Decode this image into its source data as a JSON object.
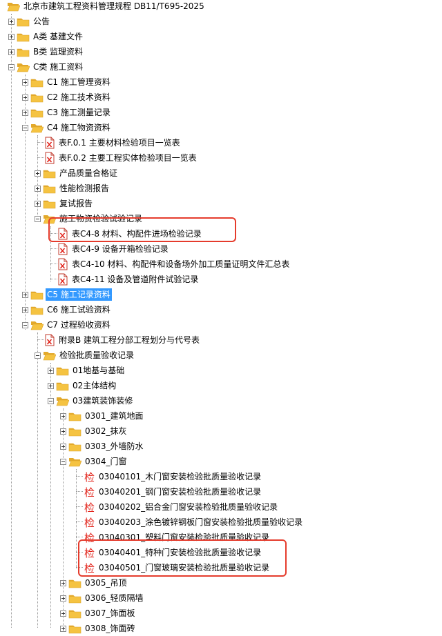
{
  "tree": {
    "root": "北京市建筑工程资料管理规程 DB11/T695-2025",
    "announcement": "公告",
    "cat_a": "A类 基建文件",
    "cat_b": "B类 监理资料",
    "cat_c": "C类 施工资料",
    "c1": "C1 施工管理资料",
    "c2": "C2 施工技术资料",
    "c3": "C3 施工测量记录",
    "c4": "C4 施工物资资料",
    "c4_f01": "表F.0.1 主要材料检验项目一览表",
    "c4_f02": "表F.0.2 主要工程实体检验项目一览表",
    "c4_cert": "产品质量合格证",
    "c4_perf": "性能检测报告",
    "c4_retest": "复试报告",
    "c4_inspect": "施工物资检验试验记录",
    "c4_8": "表C4-8 材料、构配件进场检验记录",
    "c4_9": "表C4-9 设备开箱检验记录",
    "c4_10": "表C4-10 材料、构配件和设备场外加工质量证明文件汇总表",
    "c4_11": "表C4-11 设备及管道附件试验记录",
    "c5": "C5 施工记录资料",
    "c6": "C6 施工试验资料",
    "c7": "C7 过程验收资料",
    "c7_appb": "附录B 建筑工程分部工程划分与代号表",
    "c7_batch": "检验批质量验收记录",
    "b01": "01地基与基础",
    "b02": "02主体结构",
    "b03": "03建筑装饰装修",
    "s0301": "0301_建筑地面",
    "s0302": "0302_抹灰",
    "s0303": "0303_外墙防水",
    "s0304": "0304_门窗",
    "r0101": "03040101_木门窗安装检验批质量验收记录",
    "r0201": "03040201_钢门窗安装检验批质量验收记录",
    "r0202": "03040202_铝合金门窗安装检验批质量验收记录",
    "r0203": "03040203_涂色镀锌钢板门窗安装检验批质量验收记录",
    "r0301": "03040301_塑料门窗安装检验批质量验收记录",
    "r0401": "03040401_特种门安装检验批质量验收记录",
    "r0501": "03040501_门窗玻璃安装检验批质量验收记录",
    "s0305": "0305_吊顶",
    "s0306": "0306_轻质隔墙",
    "s0307": "0307_饰面板",
    "s0308": "0308_饰面砖"
  },
  "icons": {
    "folder": "folder-icon",
    "folder_open": "folder-open-icon",
    "xls": "excel-file-icon",
    "record_glyph": "检"
  },
  "colors": {
    "selection": "#3399ff",
    "folder": "#f5c341",
    "highlight_box": "#e53b2c",
    "excel_red": "#e2231a"
  }
}
